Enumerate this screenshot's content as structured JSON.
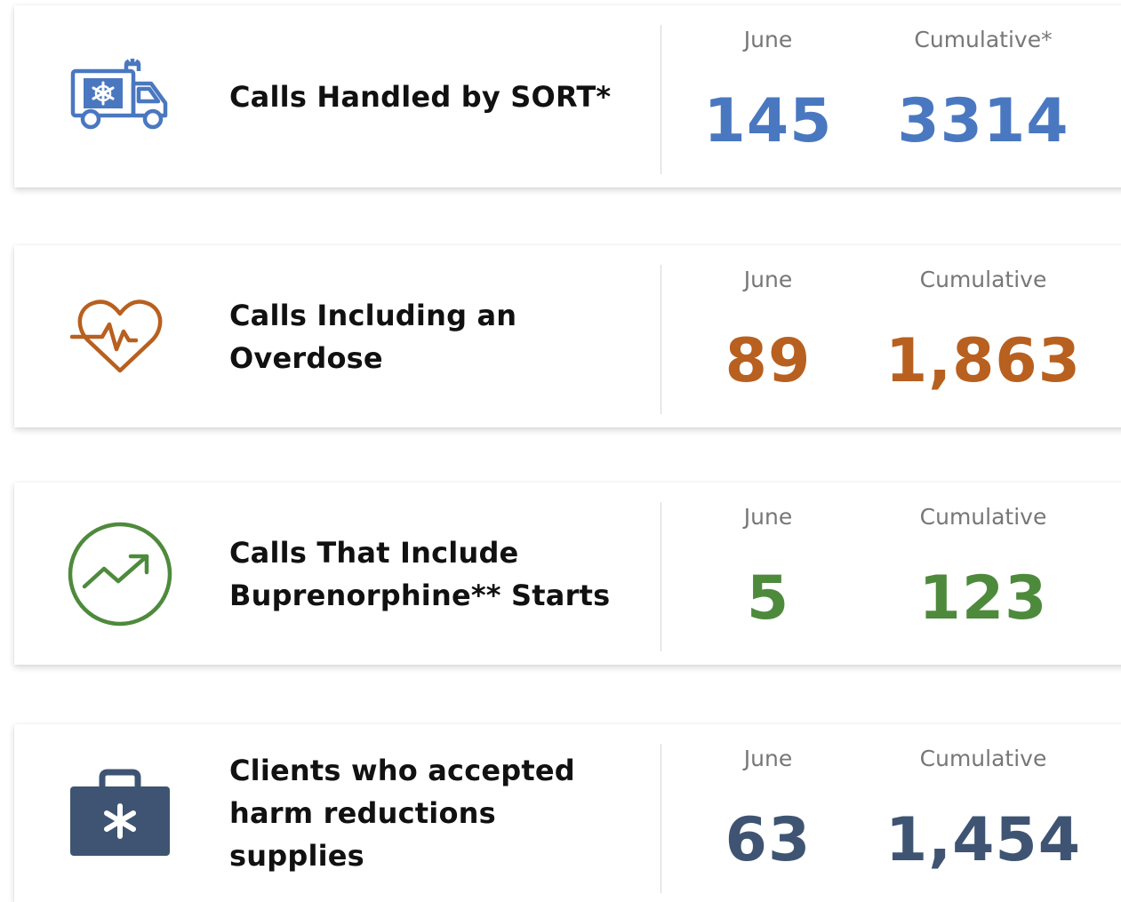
{
  "cards": [
    {
      "label_lines": [
        "Calls Handled by SORT*"
      ],
      "icon": "ambulance-icon",
      "color": "#4a78c0",
      "col_month": "June",
      "col_total": "Cumulative*",
      "month_value": "145",
      "total_value": "3314"
    },
    {
      "label_lines": [
        "Calls Including an",
        "Overdose"
      ],
      "icon": "heartbeat-icon",
      "color": "#b8601f",
      "col_month": "June",
      "col_total": "Cumulative",
      "month_value": "89",
      "total_value": "1,863"
    },
    {
      "label_lines": [
        "Calls That Include",
        "Buprenorphine** Starts"
      ],
      "icon": "trend-up-icon",
      "color": "#4e8a3c",
      "col_month": "June",
      "col_total": "Cumulative",
      "month_value": "5",
      "total_value": "123"
    },
    {
      "label_lines": [
        "Clients who accepted",
        "harm reductions supplies"
      ],
      "icon": "medical-kit-icon",
      "color": "#3e5472",
      "col_month": "June",
      "col_total": "Cumulative",
      "month_value": "63",
      "total_value": "1,454"
    }
  ]
}
